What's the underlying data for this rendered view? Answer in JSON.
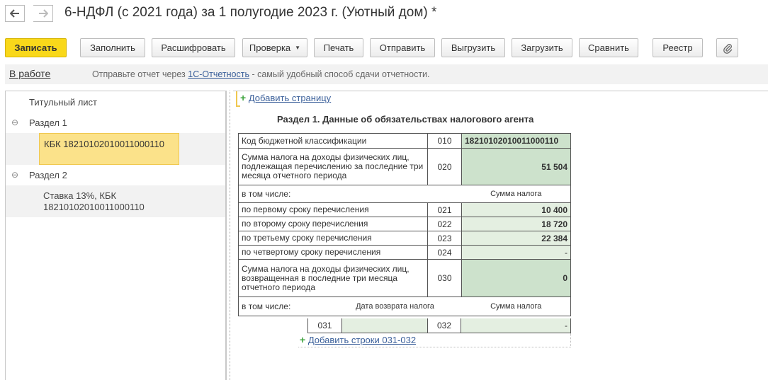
{
  "window": {
    "title": "6-НДФЛ (с 2021 года) за 1 полугодие 2023 г. (Уютный дом) *"
  },
  "toolbar": {
    "save": "Записать",
    "fill": "Заполнить",
    "decode": "Расшифровать",
    "check": "Проверка",
    "print": "Печать",
    "send": "Отправить",
    "export": "Выгрузить",
    "import": "Загрузить",
    "compare": "Сравнить",
    "registry": "Реестр"
  },
  "info": {
    "status": "В работе",
    "text_before": "Отправьте отчет через ",
    "link": "1С-Отчетность",
    "text_after": " - самый удобный способ сдачи отчетности."
  },
  "tree": {
    "title_page": "Титульный лист",
    "section1": "Раздел 1",
    "section1_child": "КБК 18210102010011000110",
    "section2": "Раздел 2",
    "section2_child_line1": "Ставка 13%, КБК",
    "section2_child_line2": "18210102010011000110"
  },
  "form": {
    "add_page": "Добавить страницу",
    "section_title": "Раздел 1. Данные об обязательствах налогового агента",
    "rows": {
      "kbk": {
        "label": "Код бюджетной классификации",
        "code": "010",
        "value": "18210102010011000110"
      },
      "tax_sum": {
        "label": "Сумма налога на доходы физических лиц, подлежащая перечислению за последние три месяца отчетного периода",
        "code": "020",
        "value": "51 504"
      },
      "including": "в том числе:",
      "tax_sum_header": "Сумма налога",
      "term1": {
        "label": "по первому сроку перечисления",
        "code": "021",
        "value": "10 400"
      },
      "term2": {
        "label": "по второму сроку перечисления",
        "code": "022",
        "value": "18 720"
      },
      "term3": {
        "label": "по третьему сроку перечисления",
        "code": "023",
        "value": "22 384"
      },
      "term4": {
        "label": "по четвертому сроку перечисления",
        "code": "024",
        "value": "-"
      },
      "returned": {
        "label": "Сумма налога на доходы физических лиц, возвращенная в последние три месяца отчетного периода",
        "code": "030",
        "value": "0"
      },
      "including2": "в том числе:",
      "return_date_header": "Дата возврата налога",
      "tax_sum_header2": "Сумма налога",
      "code031": "031",
      "value031": "",
      "code032": "032",
      "value032": "-"
    },
    "add_rows": "Добавить строки 031-032"
  }
}
